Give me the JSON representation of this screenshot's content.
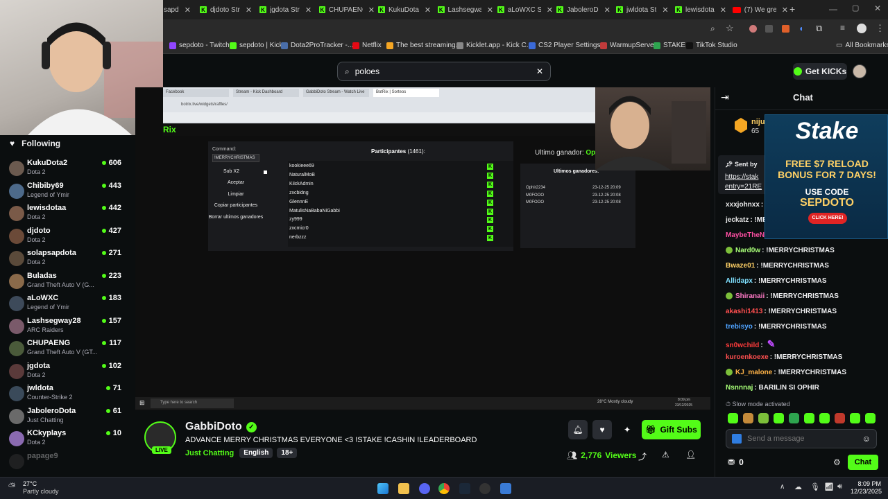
{
  "browser": {
    "tabs": [
      {
        "label": "sapd",
        "icon": "kick"
      },
      {
        "label": "djdoto Str",
        "icon": "kick"
      },
      {
        "label": "jgdota Str",
        "icon": "kick"
      },
      {
        "label": "CHUPAENC",
        "icon": "kick"
      },
      {
        "label": "KukuDota",
        "icon": "kick"
      },
      {
        "label": "Lashsegwa",
        "icon": "kick"
      },
      {
        "label": "aLoWXC S",
        "icon": "kick"
      },
      {
        "label": "JaboleroD",
        "icon": "kick"
      },
      {
        "label": "jwldota St",
        "icon": "kick"
      },
      {
        "label": "lewisdota",
        "icon": "kick"
      },
      {
        "label": "(7) We gre",
        "icon": "youtube"
      }
    ],
    "new_tab": "+",
    "bookmarks": [
      {
        "label": "sepdoto - Twitch",
        "color": "#9146ff"
      },
      {
        "label": "sepdoto | Kick",
        "color": "#53fc18"
      },
      {
        "label": "Dota2ProTracker -...",
        "color": "#4a6ea9"
      },
      {
        "label": "Netflix",
        "color": "#e50914"
      },
      {
        "label": "The best streaming...",
        "color": "#f5a623"
      },
      {
        "label": "Kicklet.app - Kick C...",
        "color": "#888888"
      },
      {
        "label": "CS2 Player Settings...",
        "color": "#3b6ad8"
      },
      {
        "label": "WarmupServer",
        "color": "#c23b3b"
      },
      {
        "label": "STAKE",
        "color": "#2ea44f"
      },
      {
        "label": "TikTok Studio",
        "color": "#111111"
      }
    ],
    "all_bookmarks": "All Bookmarks"
  },
  "kick": {
    "search_value": "poloes",
    "get_kicks": "Get KICKs",
    "following_title": "Following",
    "channels": [
      {
        "name": "KukuDota2",
        "category": "Dota 2",
        "viewers": "606",
        "color": "#6b5a4f"
      },
      {
        "name": "Chibiby69",
        "category": "Legend of Ymir",
        "viewers": "443",
        "color": "#4d6a8a"
      },
      {
        "name": "lewisdotaa",
        "category": "Dota 2",
        "viewers": "442",
        "color": "#7a5a48"
      },
      {
        "name": "djdoto",
        "category": "Dota 2",
        "viewers": "427",
        "color": "#6b4a38"
      },
      {
        "name": "solapsapdota",
        "category": "Dota 2",
        "viewers": "271",
        "color": "#5a4a3a"
      },
      {
        "name": "Buladas",
        "category": "Grand Theft Auto V (G...",
        "viewers": "223",
        "color": "#8a6a4a"
      },
      {
        "name": "aLoWXC",
        "category": "Legend of Ymir",
        "viewers": "183",
        "color": "#3d4a5a"
      },
      {
        "name": "Lashsegway28",
        "category": "ARC Raiders",
        "viewers": "157",
        "color": "#7a5a6a"
      },
      {
        "name": "CHUPAENG",
        "category": "Grand Theft Auto V (GT...",
        "viewers": "117",
        "color": "#4a5a3a"
      },
      {
        "name": "jgdota",
        "category": "Dota 2",
        "viewers": "102",
        "color": "#5a3a3a"
      },
      {
        "name": "jwldota",
        "category": "Counter-Strike 2",
        "viewers": "71",
        "color": "#3a4a5a"
      },
      {
        "name": "JaboleroDota",
        "category": "Just Chatting",
        "viewers": "61",
        "color": "#6a6a6a"
      },
      {
        "name": "KCkyplays",
        "category": "Dota 2",
        "viewers": "10",
        "color": "#8a6ab0"
      },
      {
        "name": "papage9",
        "category": "",
        "viewers": "",
        "color": "#444444"
      }
    ],
    "stream": {
      "streamer": "GabbiDoto",
      "title": "ADVANCE MERRY CHRISTMAS EVERYONE <3 !STAKE !CASHIN !LEADERBOARD",
      "category": "Just Chatting",
      "tags": [
        "English",
        "18+"
      ],
      "live_badge": "LIVE",
      "viewers": "2,776",
      "viewers_label": "Viewers",
      "gift_subs": "Gift Subs"
    },
    "chat": {
      "title": "Chat",
      "pinned_name": "niju",
      "pinned_count": "65",
      "sent_by": "Sent by",
      "link_line1": "https://stak",
      "link_line2": "entry=21RE",
      "messages": [
        {
          "user": "xxxjohnxx",
          "text": ": !M",
          "color": "#e6e6e6",
          "badge": false
        },
        {
          "user": "jeckatz",
          "text": ": !ME",
          "color": "#e6e6e6",
          "badge": false
        },
        {
          "user": "MaybeTheN",
          "text": "",
          "color": "#ff4fa3",
          "badge": false
        },
        {
          "user": "Nard0w",
          "text": ": !MERRYCHRISTMAS",
          "color": "#a8ff78",
          "badge": true
        },
        {
          "user": "Bwaze01",
          "text": ": !MERRYCHRISTMAS",
          "color": "#ffd166",
          "badge": false
        },
        {
          "user": "Allidapx",
          "text": ": !MERRYCHRISTMAS",
          "color": "#7fe0ff",
          "badge": false
        },
        {
          "user": "Shiranaii",
          "text": ": !MERRYCHRISTMAS",
          "color": "#ff79c6",
          "badge": true
        },
        {
          "user": "akashi1413",
          "text": ": !MERRYCHRISTMAS",
          "color": "#ff4f4f",
          "badge": false
        },
        {
          "user": "trebisyo",
          "text": ": !MERRYCHRISTMAS",
          "color": "#4fa3ff",
          "badge": false
        },
        {
          "user": "sn0wchild",
          "text": ":",
          "color": "#ff3c3c",
          "badge": false
        },
        {
          "user": "kuroenkoexe",
          "text": ": !MERRYCHRISTMAS",
          "color": "#ff4f4f",
          "badge": false
        },
        {
          "user": "KJ_malone",
          "text": ": !MERRYCHRISTMAS",
          "color": "#ffb347",
          "badge": true
        },
        {
          "user": "Nsnnnaj",
          "text": ": BARILIN SI OPHIR",
          "color": "#a8ff78",
          "badge": false
        }
      ],
      "slow_mode": "Slow mode activated",
      "input_placeholder": "Send a message",
      "points": "0",
      "send_button": "Chat"
    },
    "ad": {
      "brand": "Stake",
      "line1": "FREE $7 RELOAD",
      "line2": "BONUS FOR 7 DAYS!",
      "line3": "USE CODE",
      "code": "SEPDOTO",
      "cta": "CLICK HERE!"
    }
  },
  "stream_content": {
    "inner_tabs": [
      "Facebook",
      "Stream - Kick Dashboard",
      "GabbiDoto Stream - Watch Live",
      "BotRix | Sorteos"
    ],
    "inner_url": "botrix.live/widgets/raffles/",
    "command_label": "Command:",
    "command_value": "!MERRYCHRISTMAS",
    "sub_x2": "Sub X2",
    "buttons": [
      "Aceptar",
      "Limpiar",
      "Copiar participantes",
      "Borrar ultimos ganadores"
    ],
    "participants_title": "Participantes",
    "participants_count": "(1461):",
    "participants": [
      "kookieee69",
      "NaturalMoB",
      "KiickAdmin",
      "zxcbidng",
      "GlennnE",
      "MatulisNaBabaNiGabbi",
      "zy999",
      "zxcmicr0",
      "nerbzzz"
    ],
    "last_winner_label": "Ultimo ganador:",
    "last_winner_value": "Op",
    "last_winners_title": "Ultimos ganadores:",
    "winners": [
      {
        "name": "Ophir2234",
        "date": "23-12-25 20:09"
      },
      {
        "name": "M0FOOO",
        "date": "23-12-25 20:08"
      },
      {
        "name": "M0FOOO",
        "date": "23-12-25 20:08"
      }
    ],
    "inner_taskbar_search": "Type here to search",
    "inner_weather": "28°C Mostly cloudy",
    "inner_time": "8:09 pm",
    "inner_date": "23/12/2025"
  },
  "os": {
    "weather_temp": "27°C",
    "weather_desc": "Partly cloudy",
    "time": "8:09 PM",
    "date": "12/23/2025"
  }
}
